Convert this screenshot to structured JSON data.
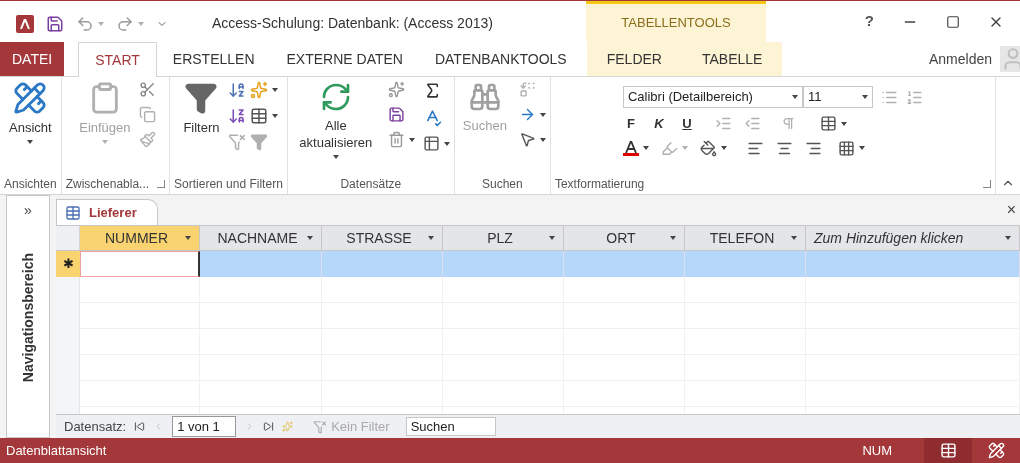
{
  "title_bar": {
    "title": "Access-Schulung: Datenbank: (Access 2013)",
    "contextual_group": "TABELLENTOOLS",
    "help": "?"
  },
  "ribbon_tabs": [
    {
      "label": "DATEI",
      "kind": "file",
      "selected": false
    },
    {
      "label": "START",
      "kind": "normal",
      "selected": true
    },
    {
      "label": "ERSTELLEN",
      "kind": "normal",
      "selected": false
    },
    {
      "label": "EXTERNE DATEN",
      "kind": "normal",
      "selected": false
    },
    {
      "label": "DATENBANKTOOLS",
      "kind": "normal",
      "selected": false
    },
    {
      "label": "FELDER",
      "kind": "contextual",
      "selected": false
    },
    {
      "label": "TABELLE",
      "kind": "contextual",
      "selected": false
    }
  ],
  "account": "Anmelden",
  "ribbon_groups": [
    {
      "kind": "views",
      "label": "Ansichten",
      "button": {
        "label": "Ansicht",
        "disabled": false,
        "dropdown": true
      }
    },
    {
      "kind": "clipboard",
      "label": "Zwischenabla...",
      "launcher": true,
      "button": {
        "label": "Einfügen",
        "disabled": true,
        "dropdown": true
      }
    },
    {
      "kind": "sort",
      "label": "Sortieren und Filtern",
      "button": {
        "label": "Filtern",
        "disabled": false
      }
    },
    {
      "kind": "records",
      "label": "Datensätze",
      "button": {
        "label": "Alle aktualisieren",
        "disabled": false,
        "dropdown": true
      }
    },
    {
      "kind": "find",
      "label": "Suchen",
      "button": {
        "label": "Suchen",
        "disabled": true
      }
    },
    {
      "kind": "text",
      "label": "Textformatierung",
      "launcher": true,
      "font": "Calibri (Detailbereich)",
      "size": "11",
      "format_letters": [
        "F",
        "K",
        "U"
      ]
    }
  ],
  "navigation_pane": {
    "label": "Navigationsbereich",
    "expand": "»"
  },
  "document_tab": {
    "label": "Lieferer",
    "close": "×"
  },
  "columns": [
    {
      "label": "NUMMER",
      "kind": "field",
      "selected": true
    },
    {
      "label": "NACHNAME",
      "kind": "field",
      "selected": false
    },
    {
      "label": "STRASSE",
      "kind": "field",
      "selected": false
    },
    {
      "label": "PLZ",
      "kind": "field",
      "selected": false
    },
    {
      "label": "ORT",
      "kind": "field",
      "selected": false
    },
    {
      "label": "TELEFON",
      "kind": "field",
      "selected": false
    },
    {
      "label": "Zum Hinzufügen klicken",
      "kind": "add",
      "selected": false
    }
  ],
  "new_record": {
    "marker": "✱",
    "selected": true
  },
  "record_navigation": {
    "label": "Datensatz:",
    "position": "1 von 1",
    "filter": "Kein Filter",
    "filter_disabled": true,
    "search_placeholder": "Suchen"
  },
  "status_bar": {
    "text": "Datenblattansicht",
    "indicator": "NUM",
    "views": [
      {
        "kind": "datasheet",
        "selected": true
      },
      {
        "kind": "design",
        "selected": false
      }
    ]
  }
}
